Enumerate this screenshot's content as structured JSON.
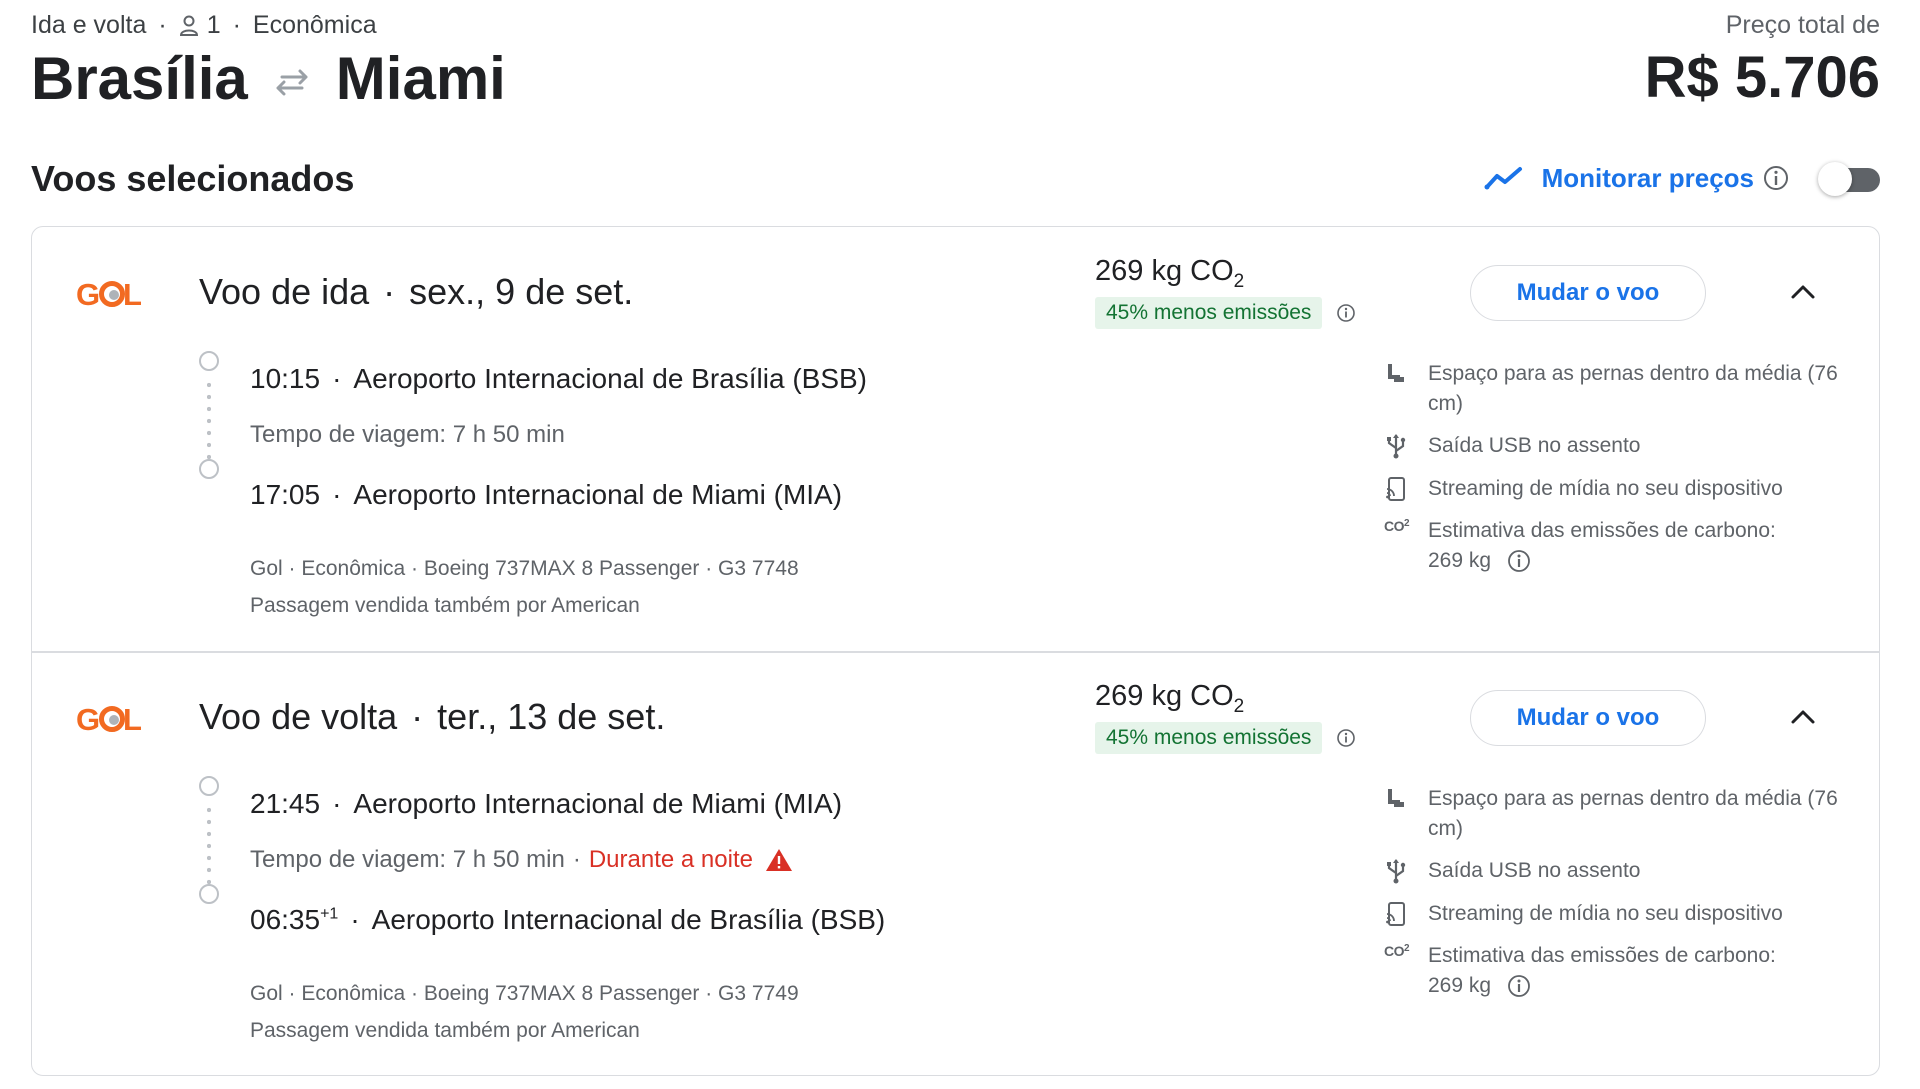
{
  "header": {
    "trip_type": "Ida e volta",
    "passengers": "1",
    "cabin": "Econômica",
    "origin": "Brasília",
    "destination": "Miami",
    "price_label": "Preço total de",
    "price_value": "R$ 5.706"
  },
  "selected": {
    "title": "Voos selecionados",
    "monitor_label": "Monitorar preços",
    "monitor_enabled": false
  },
  "colors": {
    "accent": "#1a73e8",
    "green_badge_bg": "#e6f4ea",
    "green_text": "#137333",
    "warning_red": "#d93025",
    "gol_orange": "#f26a21"
  },
  "outbound": {
    "airline_logo": "GOL",
    "label": "Voo de ida",
    "date": "sex., 9 de set.",
    "co2_value": "269 kg CO",
    "co2_sub": "2",
    "emissions_badge": "45% menos emissões",
    "change_button": "Mudar o voo",
    "depart_time": "10:15",
    "depart_airport": "Aeroporto Internacional de Brasília (BSB)",
    "travel_time": "Tempo de viagem: 7 h 50 min",
    "arrive_time": "17:05",
    "arrive_airport": "Aeroporto Internacional de Miami (MIA)",
    "details": "Gol · Econômica · Boeing 737MAX 8 Passenger · G3 7748",
    "sold_by": "Passagem vendida também por American",
    "features": {
      "legroom": "Espaço para as pernas dentro da média (76 cm)",
      "usb": "Saída USB no assento",
      "streaming": "Streaming de mídia no seu dispositivo",
      "carbon": "Estimativa das emissões de carbono:",
      "carbon_value": "269 kg"
    }
  },
  "return": {
    "airline_logo": "GOL",
    "label": "Voo de volta",
    "date": "ter., 13 de set.",
    "co2_value": "269 kg CO",
    "co2_sub": "2",
    "emissions_badge": "45% menos emissões",
    "change_button": "Mudar o voo",
    "depart_time": "21:45",
    "depart_airport": "Aeroporto Internacional de Miami (MIA)",
    "travel_time": "Tempo de viagem: 7 h 50 min",
    "travel_note": "Durante a noite",
    "arrive_time": "06:35",
    "arrive_day_offset": "+1",
    "arrive_airport": "Aeroporto Internacional de Brasília (BSB)",
    "details": "Gol · Econômica · Boeing 737MAX 8 Passenger · G3 7749",
    "sold_by": "Passagem vendida também por American",
    "features": {
      "legroom": "Espaço para as pernas dentro da média (76 cm)",
      "usb": "Saída USB no assento",
      "streaming": "Streaming de mídia no seu dispositivo",
      "carbon": "Estimativa das emissões de carbono:",
      "carbon_value": "269 kg"
    }
  },
  "icons": [
    "person-icon",
    "swap-arrows-icon",
    "trend-icon",
    "info-icon",
    "chevron-up-icon",
    "seat-icon",
    "usb-icon",
    "streaming-icon",
    "co2-icon",
    "warning-icon"
  ]
}
